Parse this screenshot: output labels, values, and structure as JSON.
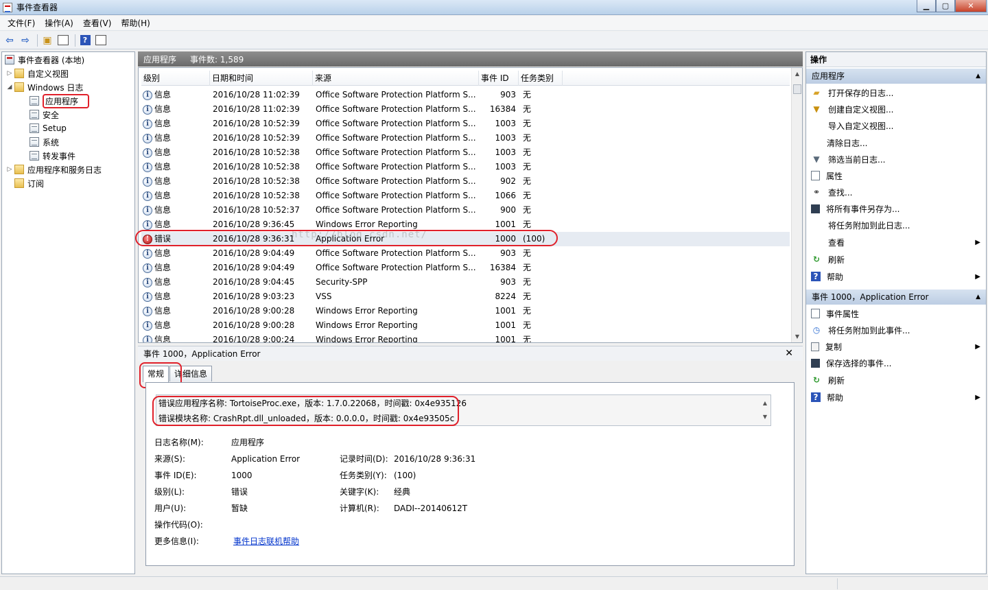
{
  "window": {
    "title": "事件查看器"
  },
  "menu": [
    "文件(F)",
    "操作(A)",
    "查看(V)",
    "帮助(H)"
  ],
  "tree": {
    "root": "事件查看器 (本地)",
    "custom_views": "自定义视图",
    "windows_logs": "Windows 日志",
    "application": "应用程序",
    "security": "安全",
    "setup": "Setup",
    "system": "系统",
    "forwarded": "转发事件",
    "app_services": "应用程序和服务日志",
    "subscriptions": "订阅"
  },
  "center": {
    "title": "应用程序",
    "count_label": "事件数: 1,589"
  },
  "columns": [
    "级别",
    "日期和时间",
    "来源",
    "事件 ID",
    "任务类别"
  ],
  "events": [
    {
      "level": "信息",
      "date": "2016/10/28 11:02:39",
      "source": "Office Software Protection Platform S...",
      "id": "903",
      "category": "无"
    },
    {
      "level": "信息",
      "date": "2016/10/28 11:02:39",
      "source": "Office Software Protection Platform S...",
      "id": "16384",
      "category": "无"
    },
    {
      "level": "信息",
      "date": "2016/10/28 10:52:39",
      "source": "Office Software Protection Platform S...",
      "id": "1003",
      "category": "无"
    },
    {
      "level": "信息",
      "date": "2016/10/28 10:52:39",
      "source": "Office Software Protection Platform S...",
      "id": "1003",
      "category": "无"
    },
    {
      "level": "信息",
      "date": "2016/10/28 10:52:38",
      "source": "Office Software Protection Platform S...",
      "id": "1003",
      "category": "无"
    },
    {
      "level": "信息",
      "date": "2016/10/28 10:52:38",
      "source": "Office Software Protection Platform S...",
      "id": "1003",
      "category": "无"
    },
    {
      "level": "信息",
      "date": "2016/10/28 10:52:38",
      "source": "Office Software Protection Platform S...",
      "id": "902",
      "category": "无"
    },
    {
      "level": "信息",
      "date": "2016/10/28 10:52:38",
      "source": "Office Software Protection Platform S...",
      "id": "1066",
      "category": "无"
    },
    {
      "level": "信息",
      "date": "2016/10/28 10:52:37",
      "source": "Office Software Protection Platform S...",
      "id": "900",
      "category": "无"
    },
    {
      "level": "信息",
      "date": "2016/10/28 9:36:45",
      "source": "Windows Error Reporting",
      "id": "1001",
      "category": "无"
    },
    {
      "level": "错误",
      "date": "2016/10/28 9:36:31",
      "source": "Application Error",
      "id": "1000",
      "category": "(100)",
      "error": true
    },
    {
      "level": "信息",
      "date": "2016/10/28 9:04:49",
      "source": "Office Software Protection Platform S...",
      "id": "903",
      "category": "无"
    },
    {
      "level": "信息",
      "date": "2016/10/28 9:04:49",
      "source": "Office Software Protection Platform S...",
      "id": "16384",
      "category": "无"
    },
    {
      "level": "信息",
      "date": "2016/10/28 9:04:45",
      "source": "Security-SPP",
      "id": "903",
      "category": "无"
    },
    {
      "level": "信息",
      "date": "2016/10/28 9:03:23",
      "source": "VSS",
      "id": "8224",
      "category": "无"
    },
    {
      "level": "信息",
      "date": "2016/10/28 9:00:28",
      "source": "Windows Error Reporting",
      "id": "1001",
      "category": "无"
    },
    {
      "level": "信息",
      "date": "2016/10/28 9:00:28",
      "source": "Windows Error Reporting",
      "id": "1001",
      "category": "无"
    },
    {
      "level": "信息",
      "date": "2016/10/28 9:00:24",
      "source": "Windows Error Reporting",
      "id": "1001",
      "category": "无"
    }
  ],
  "watermark": "http://blog.csdn.net/",
  "detail": {
    "title": "事件 1000，Application Error",
    "tab_general": "常规",
    "tab_details": "详细信息",
    "desc_line1": "错误应用程序名称: TortoiseProc.exe，版本: 1.7.0.22068，时间戳: 0x4e935126",
    "desc_line2": "错误模块名称: CrashRpt.dll_unloaded，版本: 0.0.0.0，时间戳: 0x4e93505c",
    "log_name_label": "日志名称(M):",
    "log_name": "应用程序",
    "source_label": "来源(S):",
    "source": "Application Error",
    "logged_label": "记录时间(D):",
    "logged": "2016/10/28 9:36:31",
    "event_id_label": "事件 ID(E):",
    "event_id": "1000",
    "task_label": "任务类别(Y):",
    "task": "(100)",
    "level_label": "级别(L):",
    "level": "错误",
    "keywords_label": "关键字(K):",
    "keywords": "经典",
    "user_label": "用户(U):",
    "user": "暂缺",
    "computer_label": "计算机(R):",
    "computer": "DADI--20140612T",
    "opcode_label": "操作代码(O):",
    "more_label": "更多信息(I):",
    "more_link": "事件日志联机帮助"
  },
  "actions": {
    "title": "操作",
    "section1": "应用程序",
    "items1": [
      "打开保存的日志...",
      "创建自定义视图...",
      "导入自定义视图...",
      "清除日志...",
      "筛选当前日志...",
      "属性",
      "查找...",
      "将所有事件另存为...",
      "将任务附加到此日志...",
      "查看",
      "刷新",
      "帮助"
    ],
    "section2": "事件 1000，Application Error",
    "items2": [
      "事件属性",
      "将任务附加到此事件...",
      "复制",
      "保存选择的事件...",
      "刷新",
      "帮助"
    ]
  }
}
